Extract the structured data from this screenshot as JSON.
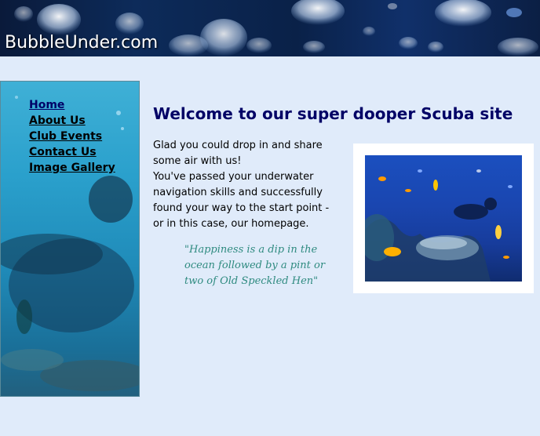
{
  "header": {
    "site_title": "BubbleUnder.com"
  },
  "nav": {
    "items": [
      {
        "label": "Home",
        "current": true
      },
      {
        "label": "About Us"
      },
      {
        "label": "Club Events"
      },
      {
        "label": "Contact Us"
      },
      {
        "label": "Image Gallery"
      }
    ]
  },
  "main": {
    "heading": "Welcome to our super dooper Scuba site",
    "intro_lines": [
      "Glad you could drop in and share",
      "some air with us!",
      "You've passed your underwater",
      "navigation skills and successfully",
      "found your way to the start point -",
      "or in this case, our homepage."
    ],
    "quote_lines": [
      "\"Happiness is a dip in the",
      "ocean followed by a pint or",
      "two of Old Speckled Hen\""
    ]
  },
  "colors": {
    "page_bg": "#e0ebfa",
    "heading": "#000066",
    "quote": "#2f8b80"
  }
}
